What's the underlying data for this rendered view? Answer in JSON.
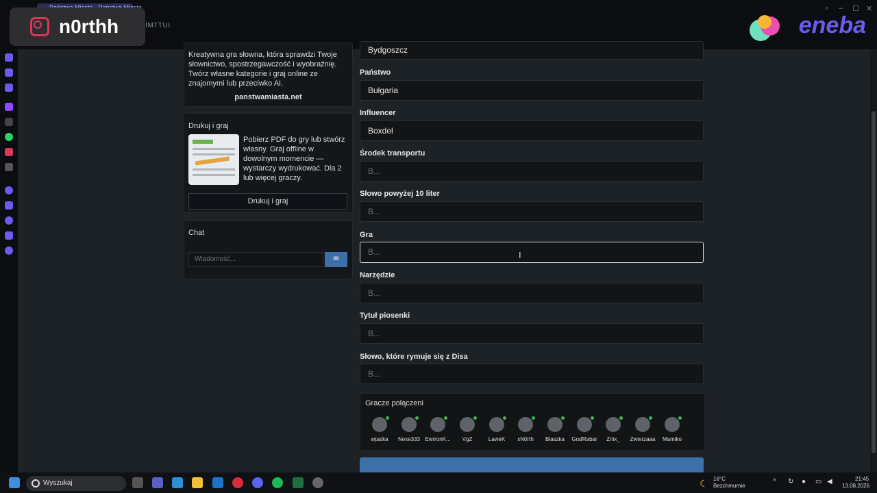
{
  "browser": {
    "tab_title": "Państwa Miasta - Państwa Miasta",
    "url_fragment": "AIMTTUI"
  },
  "overlay": {
    "username": "n0rthh",
    "sponsor": "eneba"
  },
  "left_panel": {
    "intro_text": "Kreatywna gra słowna, która sprawdzi Twoje słownictwo, spostrzegawczość i wyobraźnię. Twórz własne kategorie i graj online ze znajomymi lub przeciwko AI.",
    "site_link": "panstwamiasta.net",
    "print_title": "Drukuj i graj",
    "print_text": "Pobierz PDF do gry lub stwórz własny. Graj offline w dowolnym momencie — wystarczy wydrukować. Dla 2 lub więcej graczy.",
    "print_button": "Drukuj i graj",
    "chat_title": "Chat",
    "chat_placeholder": "Wiadomość..."
  },
  "form": {
    "top_value": "Bydgoszcz",
    "fields": [
      {
        "label": "Państwo",
        "value": "Bułgaria",
        "placeholder": ""
      },
      {
        "label": "Influencer",
        "value": "Boxdel",
        "placeholder": ""
      },
      {
        "label": "Środek transportu",
        "value": "",
        "placeholder": "B..."
      },
      {
        "label": "Słowo powyżej 10 liter",
        "value": "",
        "placeholder": "B..."
      },
      {
        "label": "Gra",
        "value": "",
        "placeholder": "B..."
      },
      {
        "label": "Narzędzie",
        "value": "",
        "placeholder": "B..."
      },
      {
        "label": "Tytuł piosenki",
        "value": "",
        "placeholder": "B..."
      },
      {
        "label": "Słowo, które rymuje się z Disa",
        "value": "",
        "placeholder": "B..."
      }
    ]
  },
  "players_panel": {
    "title": "Gracze połączeni",
    "players": [
      "wpatka",
      "Nexe333",
      "EwrronK...",
      "VgZ",
      "LaweK",
      "xN0rth",
      "Blaszka",
      "GrafRabar",
      "Znix_",
      "Zwierzaaa",
      "Mamiko"
    ]
  },
  "taskbar": {
    "search_label": "Wyszukaj",
    "weather_temp": "16°C",
    "weather_desc": "Bezchmurnie",
    "time": "21:45",
    "date": "13.08.2026"
  },
  "colors": {
    "accent_blue": "#3d6fa8",
    "online_green": "#3fb950",
    "instagram": "#e0355a"
  }
}
